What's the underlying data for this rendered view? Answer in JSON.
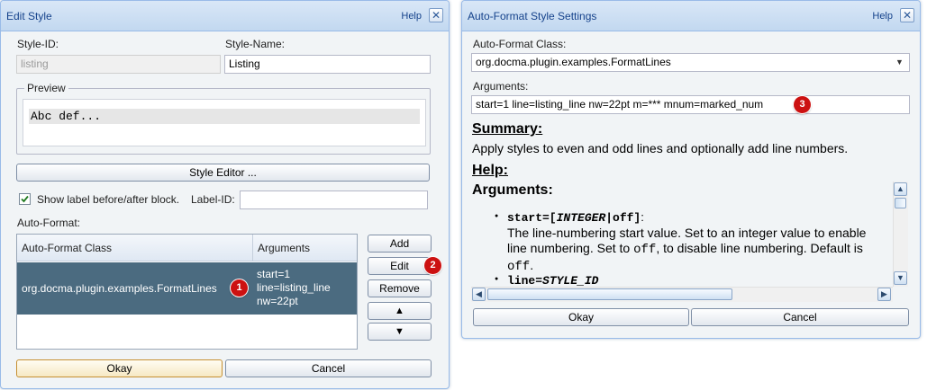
{
  "edit_style": {
    "title": "Edit Style",
    "help": "Help",
    "close": "✕",
    "style_id_label": "Style-ID:",
    "style_id_value": "listing",
    "style_name_label": "Style-Name:",
    "style_name_value": "Listing",
    "preview_legend": "Preview",
    "preview_text": "Abc def...",
    "style_editor_button": "Style Editor ...",
    "show_label_text": "Show label before/after block.",
    "label_id_label": "Label-ID:",
    "label_id_value": "",
    "auto_format_label": "Auto-Format:",
    "grid": {
      "col_class": "Auto-Format Class",
      "col_args": "Arguments",
      "row_class": "org.docma.plugin.examples.FormatLines",
      "row_args_lines": [
        "start=1",
        "line=listing_line",
        "nw=22pt"
      ]
    },
    "buttons": {
      "add": "Add",
      "edit": "Edit",
      "remove": "Remove",
      "up": "▲",
      "down": "▼",
      "okay": "Okay",
      "cancel": "Cancel"
    },
    "badges": {
      "one": "1",
      "two": "2"
    }
  },
  "auto_format": {
    "title": "Auto-Format Style Settings",
    "help": "Help",
    "close": "✕",
    "class_label": "Auto-Format Class:",
    "class_value": "org.docma.plugin.examples.FormatLines",
    "dropdown_arrow": "▼",
    "arguments_label": "Arguments:",
    "arguments_value": "start=1 line=listing_line nw=22pt m=*** mnum=marked_num",
    "badge": "3",
    "summary_heading": "Summary:",
    "summary_text": "Apply styles to even and odd lines and optionally add line numbers.",
    "help_heading": "Help:",
    "doc": {
      "arguments_heading": "Arguments:",
      "item1_code_a": "start=[",
      "item1_code_b": "INTEGER",
      "item1_code_c": "|off]",
      "item1_colon": ":",
      "item1_text_a": "The line-numbering start value. Set to an integer value to enable line numbering. Set to ",
      "item1_text_code": "off",
      "item1_text_b": ", to disable line numbering. Default is ",
      "item1_text_code2": "off",
      "item1_text_c": ".",
      "item2_code_a": "line=",
      "item2_code_b": "STYLE_ID"
    },
    "scroll": {
      "up": "▲",
      "down": "▼",
      "left": "◀",
      "right": "▶"
    },
    "buttons": {
      "okay": "Okay",
      "cancel": "Cancel"
    }
  }
}
